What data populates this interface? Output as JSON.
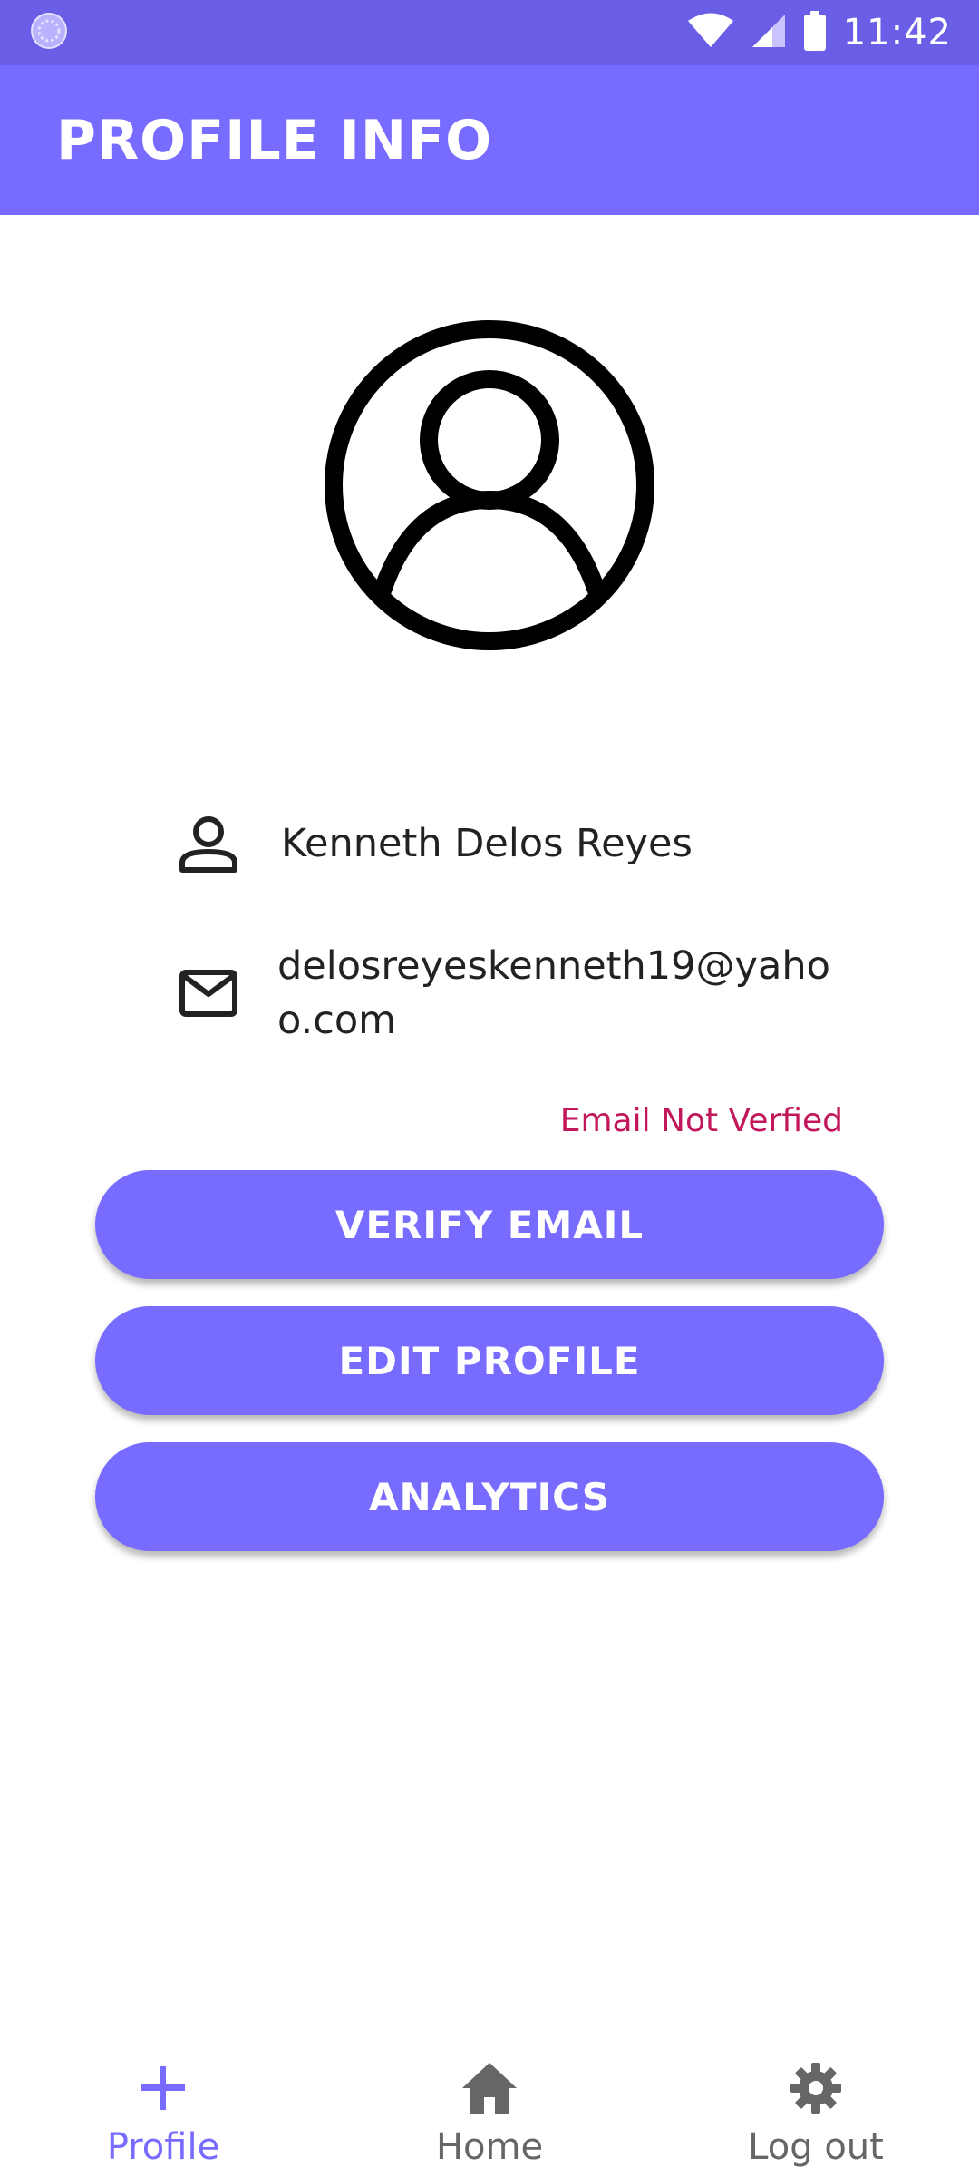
{
  "status_bar": {
    "time": "11:42"
  },
  "app_bar": {
    "title": "PROFILE INFO"
  },
  "profile": {
    "name": "Kenneth Delos Reyes",
    "email": "delosreyeskenneth19@yahoo.com",
    "verification_status": "Email Not Verfied"
  },
  "actions": {
    "verify_email": "VERIFY EMAIL",
    "edit_profile": "EDIT PROFILE",
    "analytics": "ANALYTICS"
  },
  "bottom_nav": {
    "items": [
      {
        "label": "Profile",
        "icon": "plus-icon",
        "active": true
      },
      {
        "label": "Home",
        "icon": "home-icon",
        "active": false
      },
      {
        "label": "Log out",
        "icon": "gear-icon",
        "active": false
      }
    ]
  },
  "colors": {
    "primary": "#786bff",
    "status_bar": "#6a5ee6",
    "warning_text": "#c2185b"
  }
}
